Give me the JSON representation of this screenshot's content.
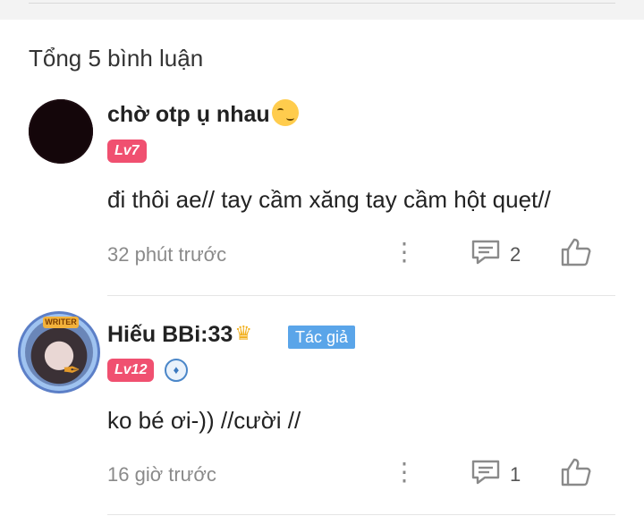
{
  "header": {
    "total_comments": "Tổng 5 bình luận"
  },
  "comments": [
    {
      "user": "chờ otp ụ nhau",
      "emoji": "smirking-face",
      "level": "Lv7",
      "text": "đi thôi ae// tay cầm xăng tay cầm hột quẹt//",
      "time": "32 phút trước",
      "reply_count": "2"
    },
    {
      "user": "Hiếu BBi:33",
      "emoji": "crown",
      "avatar_tag": "WRITER",
      "badge": "Tác giả",
      "level": "Lv12",
      "text": "ko bé ơi-)) //cười //",
      "time": "16 giờ trước",
      "reply_count": "1"
    }
  ],
  "colors": {
    "level_badge": "#f05070",
    "author_badge": "#5aa5e9",
    "muted_text": "#8a8a8a"
  }
}
